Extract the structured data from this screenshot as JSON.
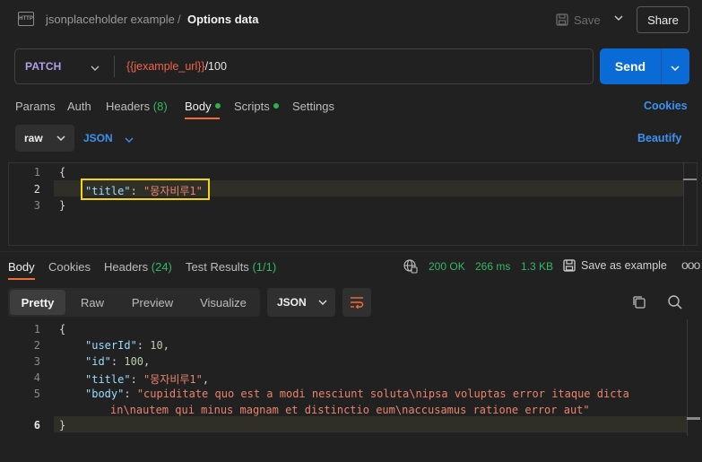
{
  "header": {
    "breadcrumb_collection": "jsonplaceholder example",
    "breadcrumb_separator": "/",
    "breadcrumb_request": "Options data",
    "save_label": "Save",
    "share_label": "Share",
    "http_icon_text": "HTTP"
  },
  "request": {
    "method": "PATCH",
    "url_variable": "{{jexample_url}}",
    "url_path": "/100",
    "send_label": "Send"
  },
  "request_tabs": [
    {
      "label": "Params",
      "count": "",
      "dot": false
    },
    {
      "label": "Auth",
      "count": "",
      "dot": false
    },
    {
      "label": "Headers",
      "count": "(8)",
      "dot": false
    },
    {
      "label": "Body",
      "count": "",
      "dot": true
    },
    {
      "label": "Scripts",
      "count": "",
      "dot": true
    },
    {
      "label": "Settings",
      "count": "",
      "dot": false
    }
  ],
  "active_request_tab": "Body",
  "cookies_label": "Cookies",
  "body_options": {
    "mode": "raw",
    "language": "JSON",
    "beautify_label": "Beautify"
  },
  "request_body": {
    "line_numbers": [
      "1",
      "2",
      "3"
    ],
    "line1": "{",
    "key": "\"title\"",
    "colon": ": ",
    "value": "\"몽자비루1\"",
    "line3": "}"
  },
  "response_tabs": [
    {
      "label": "Body",
      "count": ""
    },
    {
      "label": "Cookies",
      "count": ""
    },
    {
      "label": "Headers",
      "count": "(24)"
    },
    {
      "label": "Test Results",
      "count": "(1/1)"
    }
  ],
  "response_status": {
    "code": "200 OK",
    "time": "266 ms",
    "size": "1.3 KB",
    "save_example_label": "Save as example",
    "more_label": "ooo"
  },
  "response_views": [
    "Pretty",
    "Raw",
    "Preview",
    "Visualize"
  ],
  "active_response_view": "Pretty",
  "response_format": "JSON",
  "response_body": {
    "line_numbers": [
      "1",
      "2",
      "3",
      "4",
      "5",
      "",
      "6"
    ],
    "open": "{",
    "userId_key": "\"userId\"",
    "userId_val": "10",
    "id_key": "\"id\"",
    "id_val": "100",
    "title_key": "\"title\"",
    "title_val": "\"몽자비루1\"",
    "body_key": "\"body\"",
    "body_val_1": "\"cupiditate quo est a modi nesciunt soluta\\nipsa voluptas error itaque dicta",
    "body_val_2": "in\\nautem qui minus magnam et distinctio eum\\naccusamus ratione error aut\"",
    "close": "}"
  },
  "colors": {
    "accent_orange": "#f26b3a",
    "link_blue": "#3c91f1",
    "send_blue": "#0a6ad6",
    "status_green": "#33b864",
    "highlight_yellow": "#f5d60d"
  }
}
